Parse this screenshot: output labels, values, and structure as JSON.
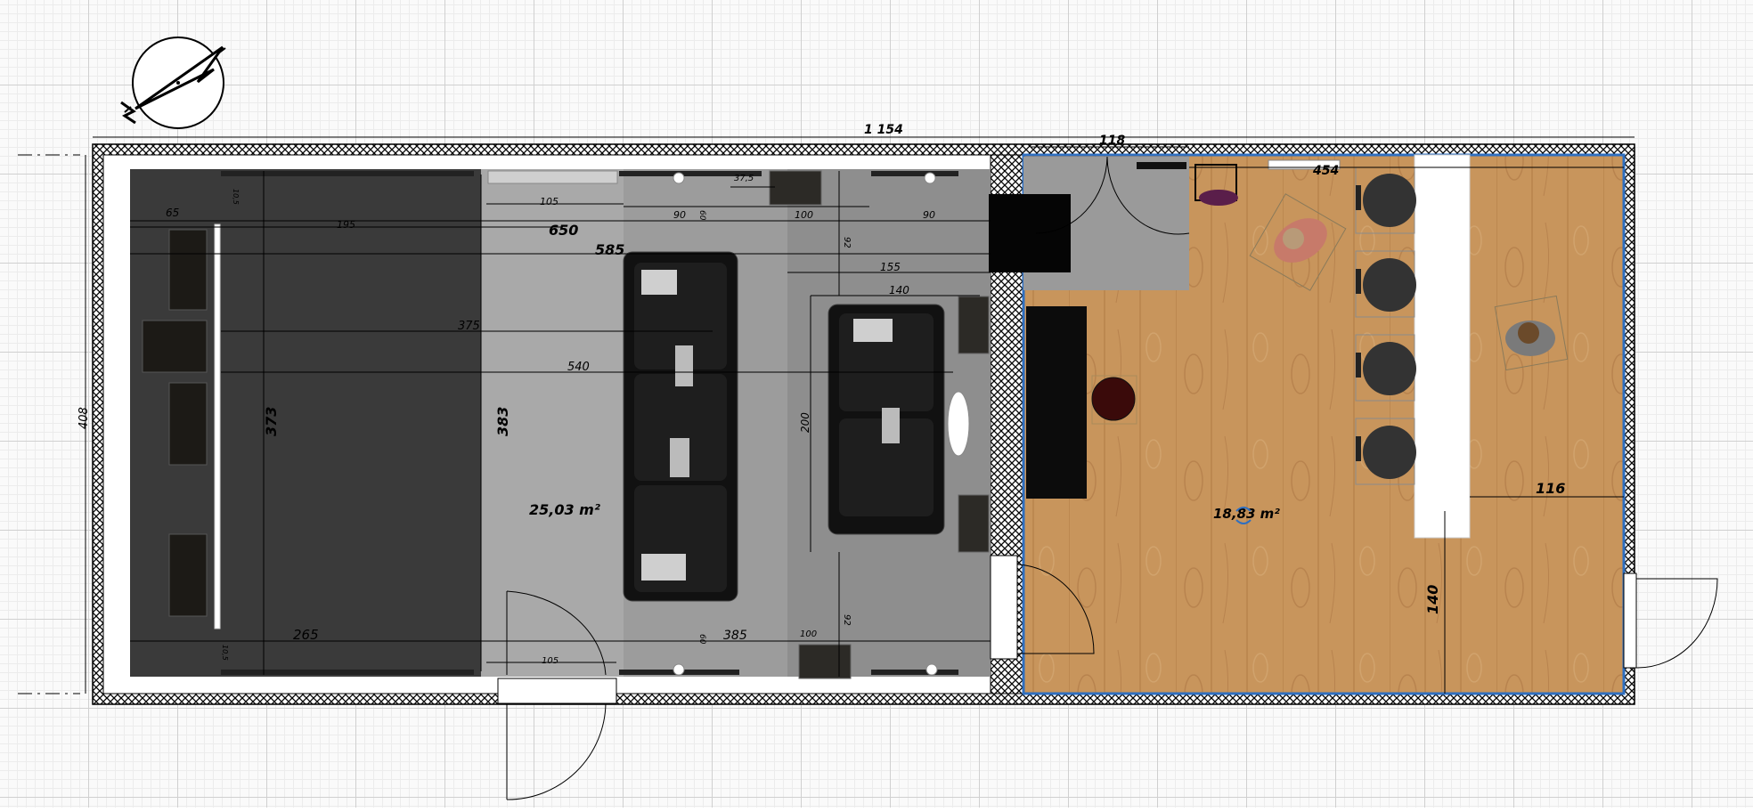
{
  "plan": {
    "rooms": [
      {
        "id": "left-room",
        "area_label": "25,03 m²"
      },
      {
        "id": "right-room",
        "area_label": "18,83 m²"
      }
    ],
    "dimensions": {
      "total_width": "1 154",
      "total_height": "408",
      "d_118": "118",
      "d_454": "454",
      "d_116": "116",
      "d_140": "140",
      "d_650": "650",
      "d_585": "585",
      "d_540": "540",
      "d_375": "375",
      "d_373": "373",
      "d_383": "383",
      "d_265": "265",
      "d_385": "385",
      "d_195": "195",
      "d_65": "65",
      "d_105_top": "105",
      "d_105_bottom": "105",
      "d_90_a": "90",
      "d_90_b": "90",
      "d_100_top": "100",
      "d_100_bottom": "100",
      "d_155": "155",
      "d_140_sofa": "140",
      "d_200": "200",
      "d_92_top": "92",
      "d_92_bottom": "92",
      "d_37_5": "37,5",
      "d_60_top": "60",
      "d_60_bottom": "60",
      "d_10_5_top": "10,5",
      "d_10_5_bottom": "10,5"
    },
    "icons": [
      "compass-icon",
      "person-icon",
      "chair-icon",
      "stool-icon",
      "sofa-icon",
      "door-icon",
      "lamp-icon"
    ],
    "colors": {
      "wall_hatch": "#000000",
      "floor_dark": "#3a3a3a",
      "floor_mid": "#9e9e9e",
      "floor_wood": "#c8955c",
      "selection": "#2f6fc0"
    }
  }
}
